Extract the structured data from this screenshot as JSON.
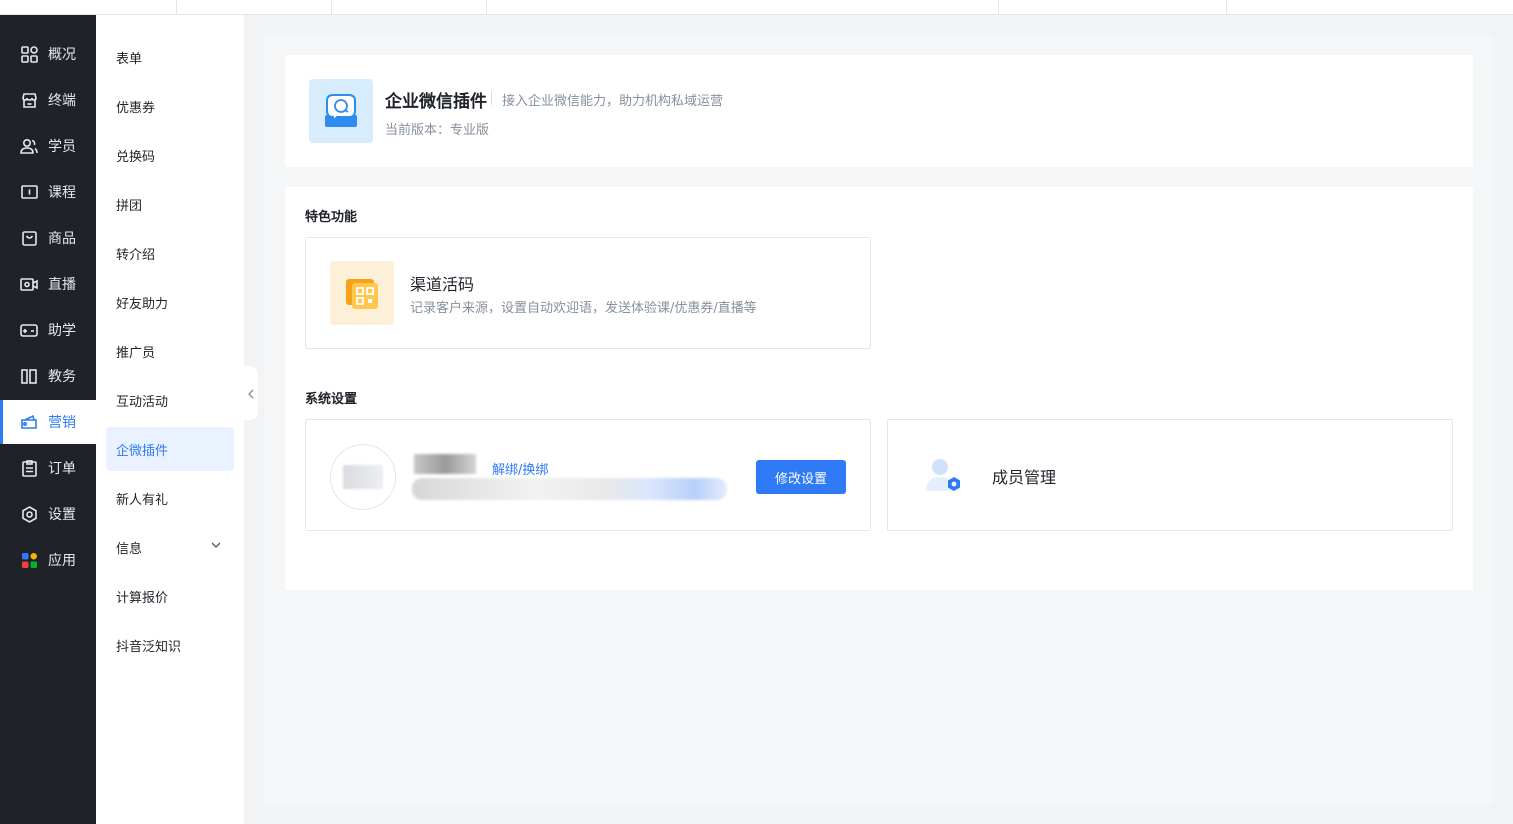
{
  "primary_nav": [
    {
      "label": "概况",
      "icon": "grid-icon"
    },
    {
      "label": "终端",
      "icon": "store-icon"
    },
    {
      "label": "学员",
      "icon": "users-icon"
    },
    {
      "label": "课程",
      "icon": "course-icon"
    },
    {
      "label": "商品",
      "icon": "bag-icon"
    },
    {
      "label": "直播",
      "icon": "live-icon"
    },
    {
      "label": "助学",
      "icon": "gamepad-icon"
    },
    {
      "label": "教务",
      "icon": "books-icon"
    },
    {
      "label": "营销",
      "icon": "coupon-icon",
      "active": true
    },
    {
      "label": "订单",
      "icon": "clipboard-icon"
    },
    {
      "label": "设置",
      "icon": "gear-icon"
    },
    {
      "label": "应用",
      "icon": "apps-icon"
    }
  ],
  "secondary_nav": [
    {
      "label": "表单"
    },
    {
      "label": "优惠券"
    },
    {
      "label": "兑换码"
    },
    {
      "label": "拼团"
    },
    {
      "label": "转介绍"
    },
    {
      "label": "好友助力"
    },
    {
      "label": "推广员"
    },
    {
      "label": "互动活动"
    },
    {
      "label": "企微插件",
      "active": true
    },
    {
      "label": "新人有礼"
    },
    {
      "label": "信息",
      "has_children": true
    },
    {
      "label": "计算报价"
    },
    {
      "label": "抖音泛知识"
    }
  ],
  "plugin": {
    "title": "企业微信插件",
    "description": "接入企业微信能力，助力机构私域运营",
    "version_label": "当前版本：专业版"
  },
  "features": {
    "section_title": "特色功能",
    "items": [
      {
        "title": "渠道活码",
        "description": "记录客户来源，设置自动欢迎语，发送体验课/优惠券/直播等"
      }
    ]
  },
  "settings": {
    "section_title": "系统设置",
    "bind": {
      "unbind_label": "解绑/换绑",
      "edit_button": "修改设置"
    },
    "member": {
      "title": "成员管理"
    }
  },
  "colors": {
    "accent": "#2f7bf5",
    "sidebar_bg": "#1f2228",
    "active_bg": "#eaf2ff"
  }
}
